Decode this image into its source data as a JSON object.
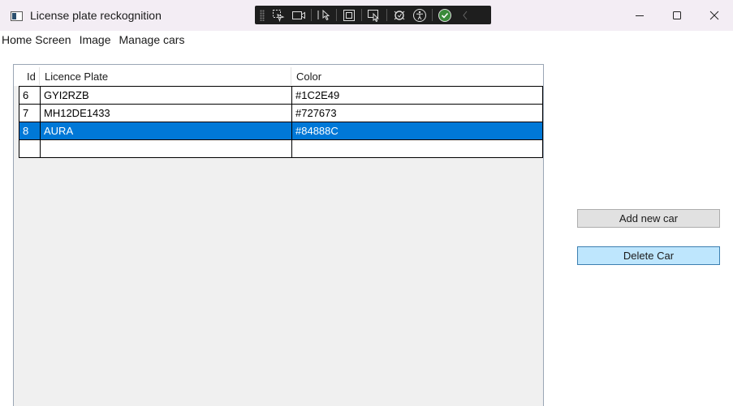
{
  "window": {
    "title": "License plate reckognition",
    "icon": "app-window-icon",
    "controls": [
      "minimize-icon",
      "maximize-icon",
      "close-icon"
    ]
  },
  "debug_toolbar": {
    "icons": [
      "select-element-icon",
      "record-icon",
      "pointer-icon",
      "layout-adorner-icon",
      "track-focus-icon",
      "hot-reload-icon",
      "accessibility-icon",
      "check-icon",
      "collapse-chevron-icon"
    ]
  },
  "menu": {
    "items": [
      {
        "label": "Home Screen"
      },
      {
        "label": "Image"
      },
      {
        "label": "Manage cars"
      }
    ]
  },
  "grid": {
    "columns": {
      "id": "Id",
      "plate": "Licence Plate",
      "color": "Color"
    },
    "rows": [
      {
        "id": "6",
        "plate": "GYI2RZB",
        "color": "#1C2E49"
      },
      {
        "id": "7",
        "plate": "MH12DE1433",
        "color": "#727673"
      },
      {
        "id": "8",
        "plate": "AURA",
        "color": "#84888C"
      },
      {
        "id": "",
        "plate": "",
        "color": ""
      }
    ],
    "selected_row": 2,
    "selection_color": "#0078d7"
  },
  "actions": {
    "add_label": "Add new car",
    "delete_label": "Delete Car"
  }
}
